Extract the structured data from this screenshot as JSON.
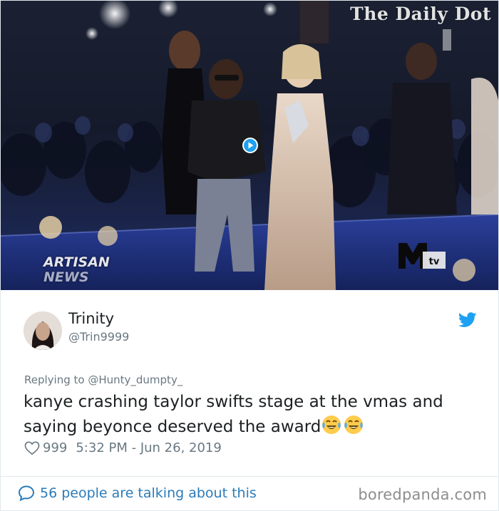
{
  "media": {
    "watermark": "The Daily Dot",
    "overlay_line1": "ARTISAN",
    "overlay_line2": "NEWS",
    "logo_text": "MTV",
    "play_icon": "play-icon"
  },
  "tweet": {
    "display_name": "Trinity",
    "handle": "@Trin9999",
    "platform_icon": "twitter-bird-icon",
    "replying_prefix": "Replying to ",
    "replying_handle": "@Hunty_dumpty_",
    "text": "kanye crashing taylor swifts stage at the vmas and saying beyonce deserved the award",
    "emojis": [
      "face-with-tears-of-joy",
      "face-with-tears-of-joy"
    ],
    "like_icon": "heart-icon",
    "like_count": "999",
    "timestamp": "5:32 PM - Jun 26, 2019"
  },
  "footer": {
    "conversation_icon": "speech-bubble-icon",
    "conversation_text": "56 people are talking about this",
    "credit": "boredpanda.com"
  },
  "colors": {
    "twitter_blue": "#1da1f2",
    "link_blue": "#2b7bb9",
    "meta_gray": "#697882",
    "text": "#1c2022",
    "border": "#e1e8ed",
    "credit_gray": "#8d8d8d"
  }
}
